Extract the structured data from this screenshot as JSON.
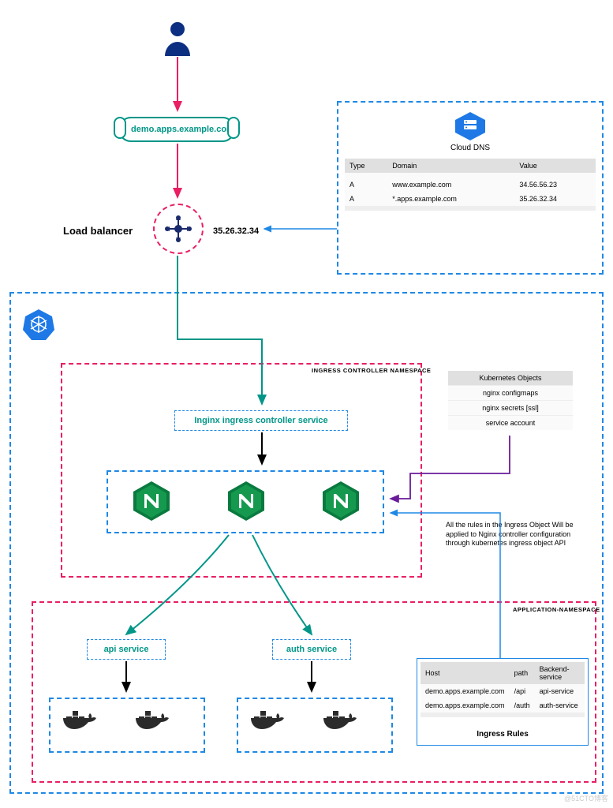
{
  "domain_node": "demo.apps.example.com",
  "lb": {
    "label": "Load balancer",
    "ip": "35.26.32.34"
  },
  "cloud_dns": {
    "label": "Cloud DNS",
    "headers": [
      "Type",
      "Domain",
      "Value"
    ],
    "rows": [
      [
        "A",
        "www.example.com",
        "34.56.56.23"
      ],
      [
        "A",
        "*.apps.example.com",
        "35.26.32.34"
      ]
    ]
  },
  "k8s_outer_label": "",
  "ingress_ns": {
    "label": "INGRESS CONTROLLER NAMESPACE",
    "service": "Inginx ingress controller service"
  },
  "kobjects": {
    "header": "Kubernetes Objects",
    "rows": [
      "nginx configmaps",
      "nginx secrets [ssl]",
      "service account"
    ]
  },
  "annotation": "All the rules in the Ingress Object Will be applied to Nginx controller configuration through kubernetes ingress object API",
  "app_ns": {
    "label": "APPLICATION-NAMESPACE",
    "svc_api": "api service",
    "svc_auth": "auth service"
  },
  "ingress_rules": {
    "title": "Ingress Rules",
    "headers": [
      "Host",
      "path",
      "Backend-service"
    ],
    "rows": [
      [
        "demo.apps.example.com",
        "/api",
        "api-service"
      ],
      [
        "demo.apps.example.com",
        "/auth",
        "auth-service"
      ]
    ]
  },
  "watermark": "@51CTO博客"
}
